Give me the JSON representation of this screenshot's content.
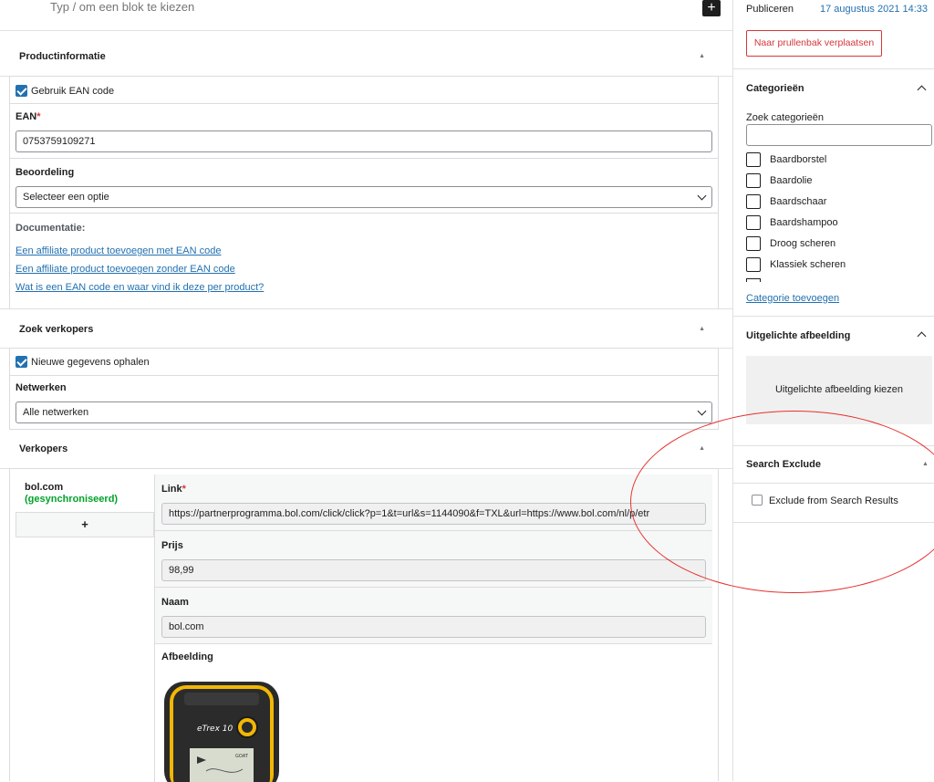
{
  "editor": {
    "block_hint": "Typ / om een blok te kiezen",
    "add_block": "+"
  },
  "product_info": {
    "title": "Productinformatie",
    "use_ean_label": "Gebruik EAN code",
    "ean_label": "EAN",
    "ean_required": "*",
    "ean_value": "0753759109271",
    "rating_label": "Beoordeling",
    "rating_value": "Selecteer een optie",
    "docs_label": "Documentatie:",
    "docs_links": [
      "Een affiliate product toevoegen met EAN code",
      "Een affiliate product toevoegen zonder EAN code",
      "Wat is een EAN code en waar vind ik deze per product?"
    ]
  },
  "find_sellers": {
    "title": "Zoek verkopers",
    "fetch_label": "Nieuwe gegevens ophalen",
    "networks_label": "Netwerken",
    "networks_value": "Alle netwerken"
  },
  "sellers": {
    "title": "Verkopers",
    "seller_name": "bol.com",
    "seller_status": "(gesynchroniseerd)",
    "add": "+",
    "link_label": "Link",
    "link_required": "*",
    "link_value": "https://partnerprogramma.bol.com/click/click?p=1&t=url&s=1144090&f=TXL&url=https://www.bol.com/nl/p/etr",
    "price_label": "Prijs",
    "price_value": "98,99",
    "name_label": "Naam",
    "name_value": "bol.com",
    "image_label": "Afbeelding",
    "device_brand": "eTrex 10",
    "device_screen": "GOAT"
  },
  "sidebar": {
    "publish_label": "Publiceren",
    "publish_date": "17 augustus 2021 14:33",
    "trash_button": "Naar prullenbak verplaatsen",
    "categories_title": "Categorieën",
    "search_categories_label": "Zoek categorieën",
    "categories": [
      "Baardborstel",
      "Baardolie",
      "Baardschaar",
      "Baardshampoo",
      "Droog scheren",
      "Klassiek scheren"
    ],
    "add_category": "Categorie toevoegen",
    "featured_title": "Uitgelichte afbeelding",
    "featured_button": "Uitgelichte afbeelding kiezen",
    "search_exclude_title": "Search Exclude",
    "exclude_label": "Exclude from Search Results"
  },
  "colors": {
    "accent": "#2271b1",
    "danger": "#d63638",
    "synced": "#00a32a",
    "annotation": "#e5322d"
  }
}
